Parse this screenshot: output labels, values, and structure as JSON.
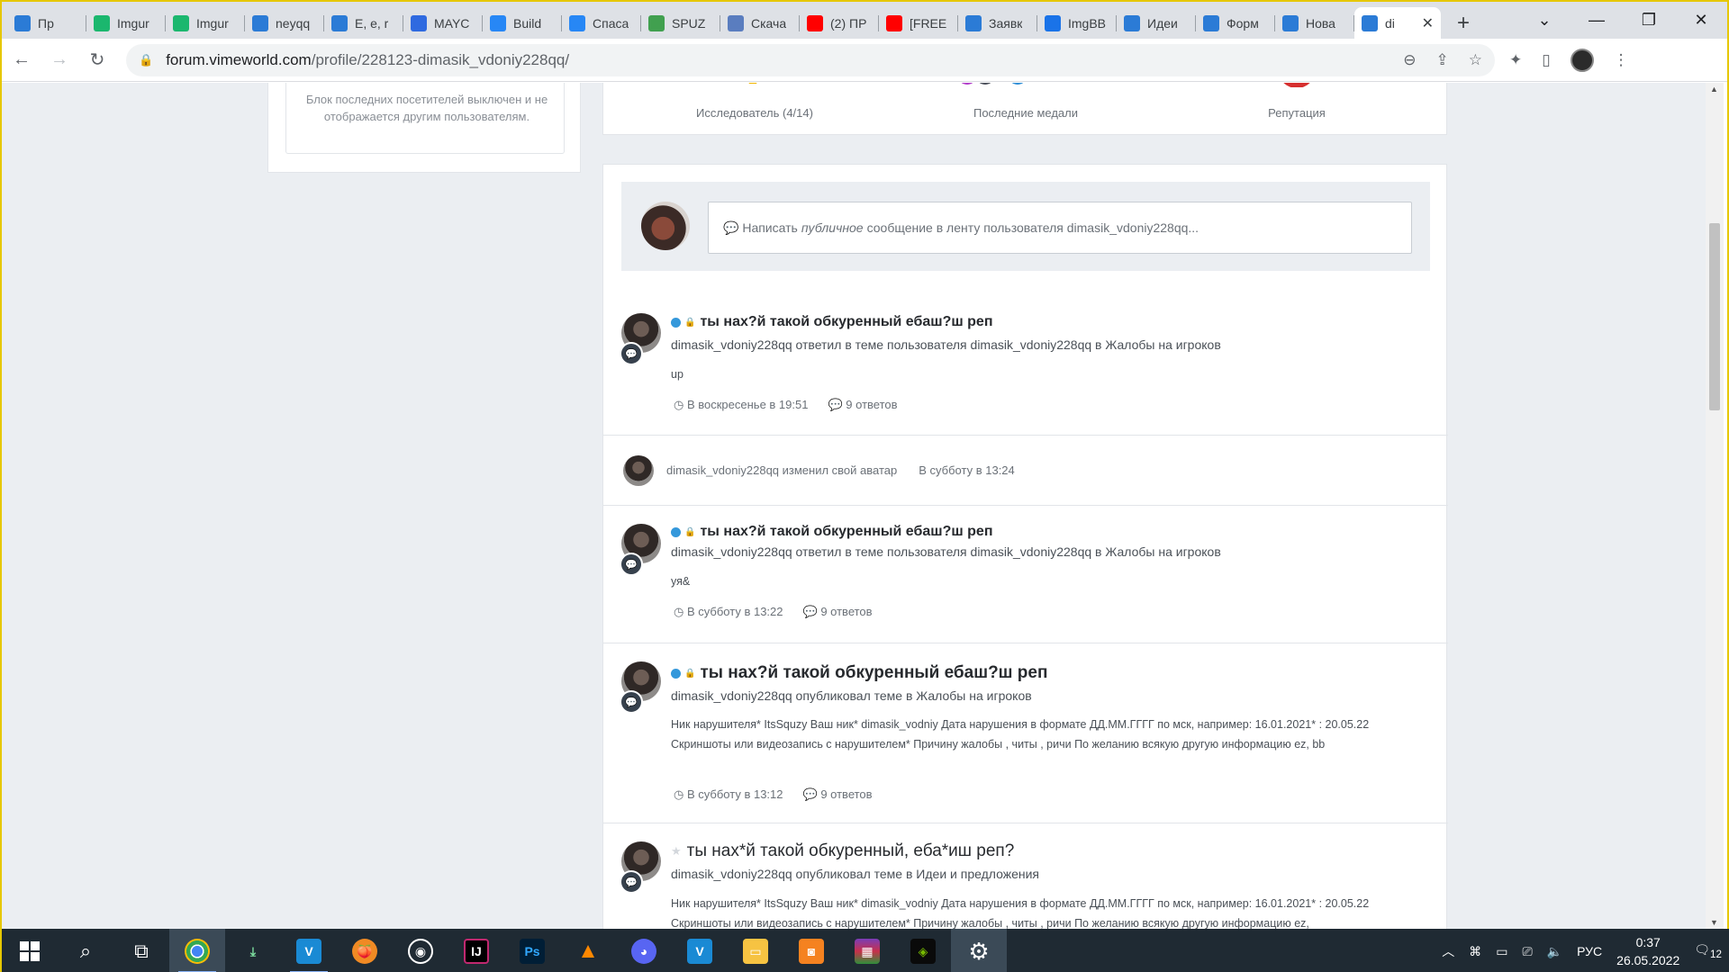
{
  "browser": {
    "tabs": [
      {
        "label": "Пр",
        "icon": "vimeworld-icon",
        "color": "#2b7bd6"
      },
      {
        "label": "Imgur",
        "icon": "imgur-icon",
        "color": "#1bb76e"
      },
      {
        "label": "Imgur",
        "icon": "imgur-icon",
        "color": "#1bb76e"
      },
      {
        "label": "neyqq",
        "icon": "vimeworld-icon",
        "color": "#2b7bd6"
      },
      {
        "label": "E, e, r",
        "icon": "vimeworld-icon",
        "color": "#2b7bd6"
      },
      {
        "label": "MAYC",
        "icon": "chat-icon",
        "color": "#2f6ae0"
      },
      {
        "label": "Build",
        "icon": "vk-icon",
        "color": "#2787f5"
      },
      {
        "label": "Спаса",
        "icon": "vk-icon",
        "color": "#2787f5"
      },
      {
        "label": "SPUZ",
        "icon": "game-icon",
        "color": "#41a04f"
      },
      {
        "label": "Скача",
        "icon": "feather-icon",
        "color": "#5a7dbf"
      },
      {
        "label": "(2) ПР",
        "icon": "youtube-icon",
        "color": "#ff0000"
      },
      {
        "label": "[FREE",
        "icon": "youtube-icon",
        "color": "#ff0000"
      },
      {
        "label": "Заявк",
        "icon": "vimeworld-icon",
        "color": "#2b7bd6"
      },
      {
        "label": "ImgBB",
        "icon": "imgbb-icon",
        "color": "#1a73e8"
      },
      {
        "label": "Идеи",
        "icon": "vimeworld-icon",
        "color": "#2b7bd6"
      },
      {
        "label": "Форм",
        "icon": "vimeworld-icon",
        "color": "#2b7bd6"
      },
      {
        "label": "Нова",
        "icon": "vimeworld-icon",
        "color": "#2b7bd6"
      },
      {
        "label": "di",
        "icon": "vimeworld-icon",
        "color": "#2b7bd6",
        "active": true
      }
    ],
    "url_host": "forum.vimeworld.com",
    "url_path": "/profile/228123-dimasik_vdoniy228qq/"
  },
  "sidebar": {
    "visitors_disabled_text": "Блок последних посетителей выключен и не отображается другим пользователям."
  },
  "stats": {
    "explorer": "Исследователь (4/14)",
    "medals": "Последние медали",
    "reputation": "Репутация"
  },
  "composer": {
    "prefix": "Написать",
    "emphasis": "публичное",
    "suffix": "сообщение в ленту пользователя dimasik_vdoniy228qq..."
  },
  "feed": [
    {
      "title": "ты нах?й такой обкуренный ебаш?ш реп",
      "meta": "dimasik_vdoniy228qq ответил в теме пользователя dimasik_vdoniy228qq в Жалобы на игроков",
      "body": "up",
      "time": "В воскресенье в 19:51",
      "replies": "9 ответов"
    },
    {
      "mini": true,
      "text": "dimasik_vdoniy228qq изменил свой аватар",
      "time": "В субботу в 13:24"
    },
    {
      "title": "ты нах?й такой обкуренный ебаш?ш реп",
      "meta": "dimasik_vdoniy228qq ответил в теме пользователя dimasik_vdoniy228qq в Жалобы на игроков",
      "body": "уя&",
      "time": "В субботу в 13:22",
      "replies": "9 ответов"
    },
    {
      "title": "ты нах?й такой обкуренный ебаш?ш реп",
      "meta": "dimasik_vdoniy228qq опубликовал теме в Жалобы на игроков",
      "body": "Ник нарушителя* ItsSquzy Ваш ник* dimasik_vodniy Дата нарушения в формате ДД.ММ.ГГГГ по мск, например: 16.01.2021* : 20.05.22 Скриншоты или видеозапись с нарушителем* Причину жалобы , читы , ричи По желанию всякую другую информацию ez, bb",
      "time": "В субботу в 13:12",
      "replies": "9 ответов"
    },
    {
      "title": "ты нах*й такой обкуренный, еба*иш реп?",
      "meta": "dimasik_vdoniy228qq опубликовал теме в Идеи и предложения",
      "body": "Ник нарушителя* ItsSquzy Ваш ник* dimasik_vodniy Дата нарушения в формате ДД.ММ.ГГГГ по мск, например: 16.01.2021* : 20.05.22 Скриншоты или видеозапись с нарушителем* Причину жалобы , читы , ричи По желанию всякую другую информацию ez,"
    }
  ],
  "taskbar": {
    "lang": "РУС",
    "time": "0:37",
    "date": "26.05.2022",
    "notif_count": "12"
  }
}
